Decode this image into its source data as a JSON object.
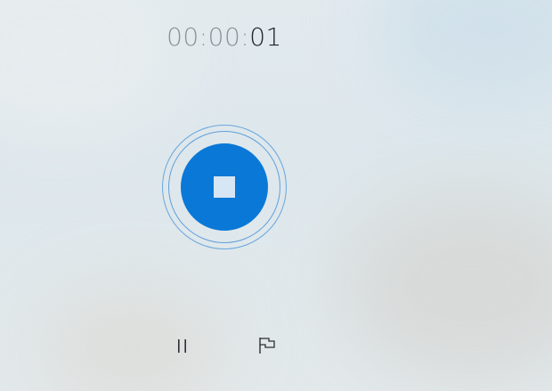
{
  "recorder": {
    "timer": {
      "dim": "00:00:",
      "bright": "01"
    },
    "stop_button": {
      "icon": "stop-square-icon"
    },
    "controls": {
      "pause": {
        "icon": "pause-icon"
      },
      "marker": {
        "icon": "flag-icon"
      }
    }
  },
  "colors": {
    "accent": "#0a78d7",
    "ring": "#6aa6dc",
    "timer_dim": "#8d9296",
    "timer_bright": "#1d2226",
    "icon": "#2b2f33"
  }
}
